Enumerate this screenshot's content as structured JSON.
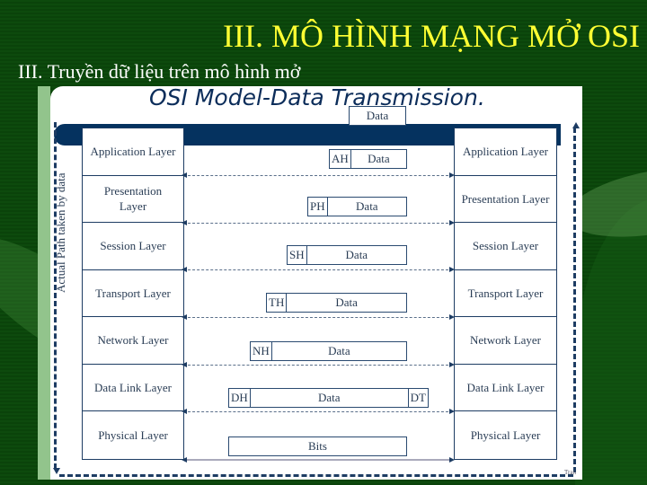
{
  "slide": {
    "title": "III. MÔ HÌNH MẠNG MỞ OSI",
    "subtitle": "III. Truyền dữ liệu trên mô hình mở"
  },
  "diagram": {
    "title": "OSI Model-Data Transmission.",
    "side_label": "Actual Path taken by data",
    "corner_label": "Tran",
    "left_layers": [
      "Application Layer",
      "Presentation Layer",
      "Session Layer",
      "Transport Layer",
      "Network Layer",
      "Data Link Layer",
      "Physical Layer"
    ],
    "right_layers": [
      "Application Layer",
      "Presentation Layer",
      "Session Layer",
      "Transport Layer",
      "Network Layer",
      "Data Link Layer",
      "Physical Layer"
    ],
    "top_data": "Data",
    "pdus": [
      {
        "header": "AH",
        "data": "Data",
        "trailer": ""
      },
      {
        "header": "PH",
        "data": "Data",
        "trailer": ""
      },
      {
        "header": "SH",
        "data": "Data",
        "trailer": ""
      },
      {
        "header": "TH",
        "data": "Data",
        "trailer": ""
      },
      {
        "header": "NH",
        "data": "Data",
        "trailer": ""
      },
      {
        "header": "DH",
        "data": "Data",
        "trailer": "DT"
      },
      {
        "header": "",
        "data": "Bits",
        "trailer": ""
      }
    ]
  },
  "colors": {
    "background": "#0d4a0d",
    "title": "#ffff33",
    "bar": "#05325f"
  }
}
